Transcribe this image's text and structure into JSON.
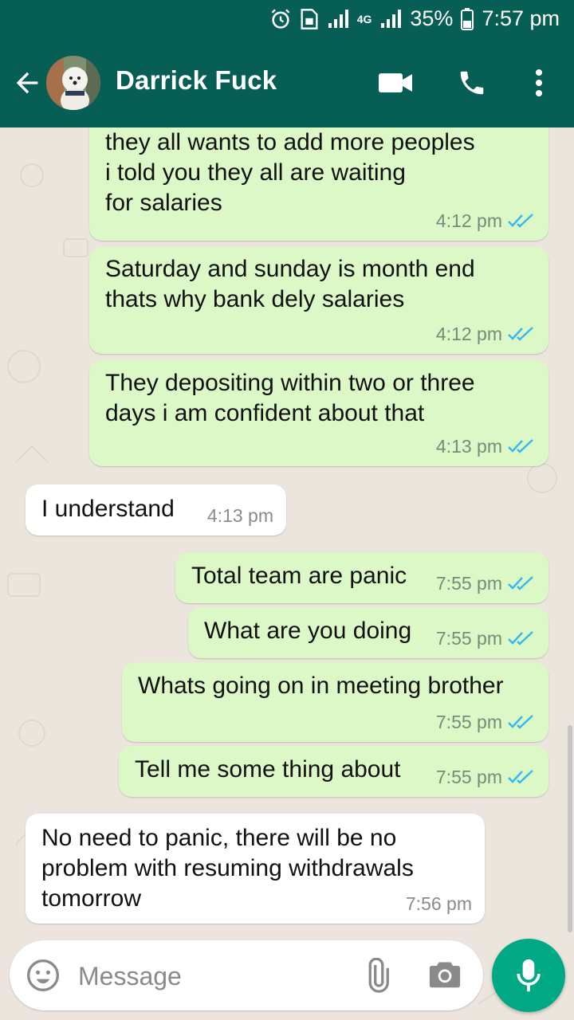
{
  "status_bar": {
    "battery": "35%",
    "time": "7:57 pm",
    "network": "4G"
  },
  "header": {
    "contact_name": "Darrick Fuck"
  },
  "messages": [
    {
      "dir": "out",
      "lines": "They all waiting for company check\nthey all wants to add more peoples\ni told you they all are waiting\nfor salaries",
      "time": "4:12 pm",
      "status": "read"
    },
    {
      "dir": "out",
      "lines": "Saturday and sunday is month end\nthats why bank dely salaries",
      "time": "4:12 pm",
      "status": "read"
    },
    {
      "dir": "out",
      "lines": "They depositing within two or three\ndays i am confident about that",
      "time": "4:13 pm",
      "status": "read"
    },
    {
      "dir": "in",
      "lines": "I understand",
      "time": "4:13 pm"
    },
    {
      "dir": "out",
      "lines": "Total team are panic",
      "time": "7:55 pm",
      "status": "read"
    },
    {
      "dir": "out",
      "lines": "What are you doing",
      "time": "7:55 pm",
      "status": "read"
    },
    {
      "dir": "out",
      "lines": "Whats going on in meeting brother",
      "time": "7:55 pm",
      "status": "read"
    },
    {
      "dir": "out",
      "lines": "Tell me some thing about",
      "time": "7:55 pm",
      "status": "read"
    },
    {
      "dir": "in",
      "lines": "No need to panic, there will be no\nproblem with resuming withdrawals\ntomorrow",
      "time": "7:56 pm"
    }
  ],
  "composer": {
    "placeholder": "Message"
  },
  "icons": {
    "back": "arrow-back-icon",
    "video": "video-call-icon",
    "call": "phone-icon",
    "menu": "more-vert-icon",
    "emoji": "emoji-icon",
    "attach": "attach-icon",
    "camera": "camera-icon",
    "mic": "mic-icon"
  },
  "colors": {
    "header": "#075e54",
    "outgoing": "#dcf8c6",
    "incoming": "#ffffff",
    "read_tick": "#34b7f1",
    "mic": "#00a884",
    "wallpaper": "#ece5dd"
  }
}
